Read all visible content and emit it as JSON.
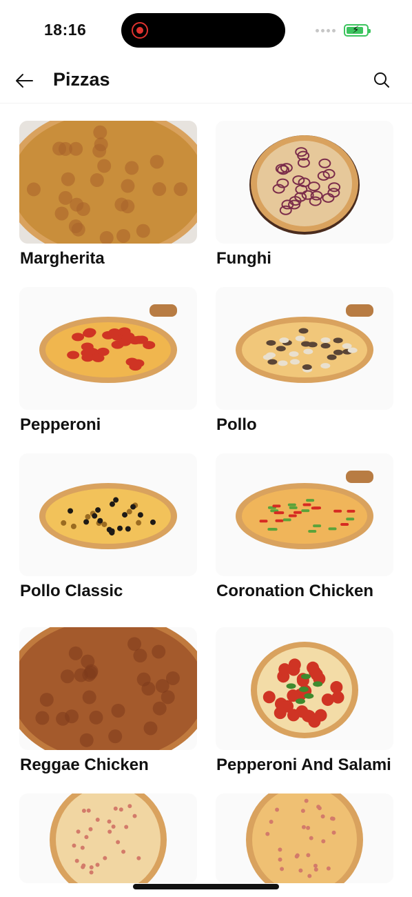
{
  "status_bar": {
    "time": "18:16",
    "battery_level": 0.85,
    "recording_indicator": "red-record-icon",
    "colors": {
      "recording": "#e0332f",
      "battery": "#3cc45e"
    }
  },
  "header": {
    "title": "Pizzas",
    "back_icon": "arrow-left-icon",
    "search_icon": "search-icon"
  },
  "pizzas": [
    {
      "name": "Margherita",
      "image": "margherita-photo",
      "style": "cheese"
    },
    {
      "name": "Funghi",
      "image": "funghi-photo",
      "style": "mushroom"
    },
    {
      "name": "Pepperoni",
      "image": "pepperoni-photo",
      "style": "pepperoni"
    },
    {
      "name": "Pollo",
      "image": "pollo-photo",
      "style": "pollo"
    },
    {
      "name": "Pollo Classic",
      "image": "pollo-classic-photo",
      "style": "olive"
    },
    {
      "name": "Coronation Chicken",
      "image": "coronation-chicken-photo",
      "style": "pepper"
    },
    {
      "name": "Reggae Chicken",
      "image": "reggae-chicken-photo",
      "style": "bbq"
    },
    {
      "name": "Pepperoni And Salami",
      "image": "pepperoni-and-salami-photo",
      "style": "salami"
    },
    {
      "name": "",
      "image": "pizza-photo",
      "style": "ham"
    },
    {
      "name": "",
      "image": "pizza-photo",
      "style": "slice"
    }
  ]
}
